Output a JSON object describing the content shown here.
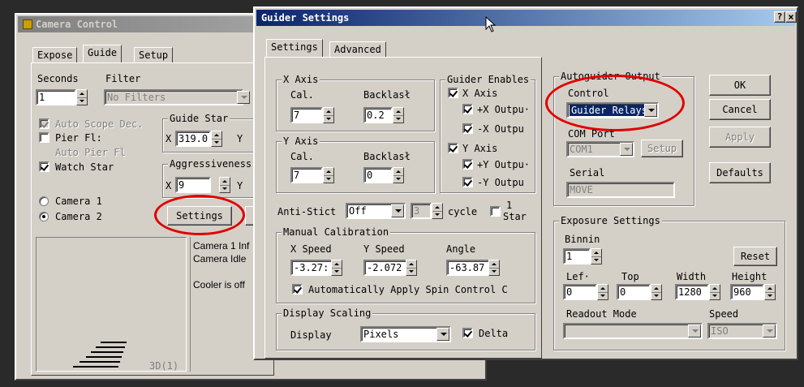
{
  "camera_control": {
    "title": "Camera Control",
    "tabs": [
      "Expose",
      "Guide",
      "Setup"
    ],
    "seconds_label": "Seconds",
    "filter_label": "Filter",
    "seconds_value": "1",
    "filter_value": "No Filters",
    "auto_scope_dec": "Auto Scope Dec.",
    "pier_flip": "Pier Fl:",
    "auto_pier_flip": "Auto Pier Fl",
    "watch_star": "Watch Star",
    "guide_star_legend": "Guide Star",
    "guide_x_label": "X",
    "guide_x_value": "319.0",
    "guide_y_label": "Y",
    "aggressiveness_legend": "Aggressiveness",
    "aggr_x_label": "X",
    "aggr_x_value": "9",
    "aggr_y_label": "Y",
    "camera1": "Camera 1",
    "camera2": "Camera 2",
    "settings_button": "Settings",
    "status_lines": [
      "Camera 1 Inf",
      "Camera Idle",
      "Cooler is off"
    ],
    "preview_label": "3D(1)"
  },
  "guider_settings": {
    "title": "Guider Settings",
    "help_button": "?",
    "close_button": "×",
    "tabs": [
      "Settings",
      "Advanced"
    ],
    "x_axis": {
      "legend": "X Axis",
      "cal_label": "Cal.",
      "backlash_label": "Backlasł",
      "cal_value": "7",
      "backlash_value": "0.2"
    },
    "y_axis": {
      "legend": "Y Axis",
      "cal_label": "Cal.",
      "backlash_label": "Backlasł",
      "cal_value": "7",
      "backlash_value": "0"
    },
    "guider_enables": {
      "legend": "Guider Enables",
      "x_axis": "X Axis",
      "plus_x": "+X Outpu·",
      "minus_x": "-X Outpu",
      "y_axis": "Y Axis",
      "plus_y": "+Y Outpu·",
      "minus_y": "-Y Outpu"
    },
    "anti_stiction": {
      "label": "Anti-Stict",
      "value": "Off",
      "cycle_value": "3",
      "cycle_label": "cycle",
      "star_label_1": "1",
      "star_label_2": "Star"
    },
    "manual_calibration": {
      "legend": "Manual Calibration",
      "x_speed_label": "X Speed",
      "y_speed_label": "Y Speed",
      "angle_label": "Angle",
      "x_speed_value": "-3.27:",
      "y_speed_value": "-2.072",
      "angle_value": "-63.87",
      "auto_spin": "Automatically Apply Spin Control C"
    },
    "display_scaling": {
      "legend": "Display Scaling",
      "display_label": "Display",
      "display_value": "Pixels",
      "delta_label": "Delta"
    },
    "autoguider_output": {
      "legend": "Autoguider Output",
      "control_label": "Control",
      "control_value": "Guider Relays",
      "com_port_label": "COM Port",
      "com_port_value": "COM1",
      "setup_button": "Setup",
      "serial_label": "Serial",
      "serial_value": "MOVE"
    },
    "buttons": {
      "ok": "OK",
      "cancel": "Cancel",
      "apply": "Apply",
      "defaults": "Defaults"
    },
    "exposure_settings": {
      "legend": "Exposure Settings",
      "binning_label": "Binnin",
      "binning_value": "1",
      "reset_button": "Reset",
      "left_label": "Lef·",
      "top_label": "Top",
      "width_label": "Width",
      "height_label": "Height",
      "left_value": "0",
      "top_value": "0",
      "width_value": "1280",
      "height_value": "960",
      "readout_label": "Readout Mode",
      "readout_value": "",
      "speed_label": "Speed",
      "speed_value": "ISO"
    }
  },
  "colors": {
    "title_active": "#0a246a",
    "title_inactive": "#808080",
    "highlight_ring": "#e00000",
    "selection": "#0a246a"
  }
}
